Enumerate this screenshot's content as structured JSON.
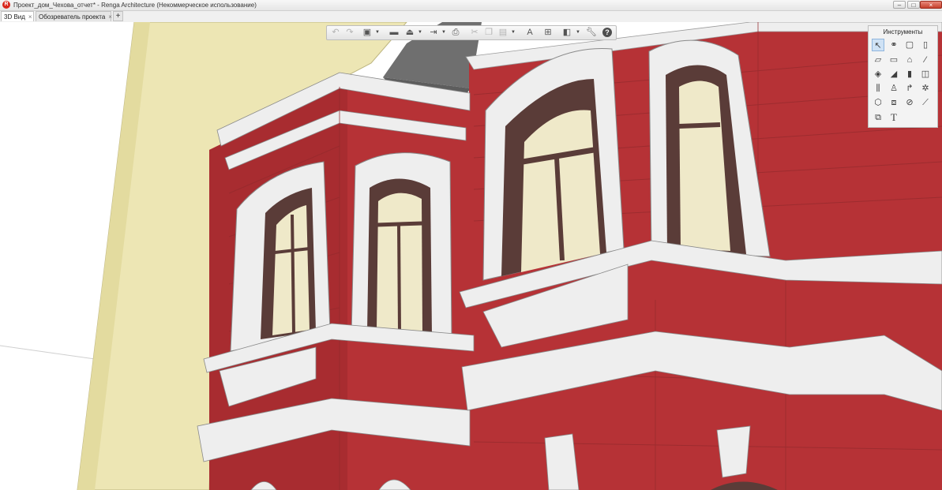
{
  "window": {
    "title": "Проект_дом_Чехова_отчет* - Renga Architecture (Некоммерческое использование)",
    "app_icon": "renga-logo-icon",
    "controls": [
      "minimize-icon",
      "maximize-icon",
      "close-icon"
    ]
  },
  "tabs": [
    {
      "label": "3D Вид",
      "close": "×",
      "active": true
    },
    {
      "label": "Обозреватель проекта",
      "close": "×",
      "active": false
    }
  ],
  "tab_add": "+",
  "toolbar": {
    "buttons": [
      "undo-icon",
      "redo-icon",
      "view-cube-icon",
      "section-icon",
      "level-icon",
      "export-icon",
      "print-icon",
      "cut-icon",
      "copy-icon",
      "paste-icon",
      "text-style-icon",
      "grid-icon",
      "display-mode-icon",
      "settings-wrench-icon",
      "help-icon"
    ]
  },
  "tools_panel": {
    "title": "Инструменты",
    "tools": [
      "select-icon",
      "link-icon",
      "room-icon",
      "column-icon",
      "wall-icon",
      "floor-slab-icon",
      "roof-icon",
      "beam-icon",
      "stairs-icon",
      "ramp-icon",
      "door-icon",
      "window-icon",
      "railing-icon",
      "plumbing-icon",
      "pipe-icon",
      "equipment-icon",
      "opening-icon",
      "hole-icon",
      "dimension-icon",
      "ruler-icon",
      "assembly-icon",
      "text-icon"
    ],
    "text_tool_label": "T"
  },
  "colors": {
    "brick": "#b63236",
    "brick_dark": "#922327",
    "trim": "#eeeeee",
    "window_frame": "#5a3c38",
    "glass": "#efe9c9",
    "wall_beige": "#ede6b4",
    "roof": "#6f6f6f"
  }
}
